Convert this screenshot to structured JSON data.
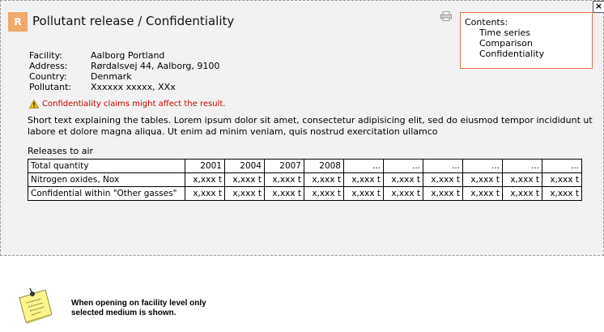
{
  "header": {
    "logo_letter": "R",
    "title": "Pollutant release / Confidentiality",
    "close_label": "×"
  },
  "contents": {
    "heading": "Contents:",
    "items": [
      "Time series",
      "Comparison",
      "Confidentiality"
    ]
  },
  "facility": {
    "rows": [
      {
        "label": "Facility:",
        "value": "Aalborg Portland"
      },
      {
        "label": "Address:",
        "value": "Rørdalsvej 44, Aalborg, 9100"
      },
      {
        "label": "Country:",
        "value": "Denmark"
      },
      {
        "label": "Pollutant:",
        "value": "Xxxxxx xxxxx, XXx"
      }
    ]
  },
  "warning": {
    "text": "Confidentiality claims might affect the result.",
    "color": "#cc0000",
    "icon": "warning-triangle-icon"
  },
  "description": "Short text explaining the tables. Lorem ipsum dolor sit amet, consectetur adipisicing elit, sed do eiusmod tempor incididunt ut labore et dolore magna aliqua. Ut enim ad minim veniam, quis nostrud exercitation ullamco",
  "table": {
    "heading": "Releases to air",
    "header_row": [
      "Total quantity",
      "2001",
      "2004",
      "2007",
      "2008",
      "...",
      "...",
      "...",
      "...",
      "...",
      "..."
    ],
    "rows": [
      [
        "Nitrogen oxides, Nox",
        "x,xxx t",
        "x,xxx t",
        "x,xxx t",
        "x,xxx t",
        "x,xxx t",
        "x,xxx t",
        "x,xxx t",
        "x,xxx t",
        "x,xxx t",
        "x,xxx t"
      ],
      [
        "Confidential within \"Other gasses\"",
        "x,xxx t",
        "x,xxx t",
        "x,xxx t",
        "x,xxx t",
        "x,xxx t",
        "x,xxx t",
        "x,xxx t",
        "x,xxx t",
        "x,xxx t",
        "x,xxx t"
      ]
    ]
  },
  "sticky_note": {
    "text": "When opening on facility level only selected medium is shown.",
    "icon": "sticky-note-icon"
  },
  "colors": {
    "accent": "#f0a86b",
    "contents_border": "#e6704f",
    "panel_bg": "#f2f2f2"
  }
}
